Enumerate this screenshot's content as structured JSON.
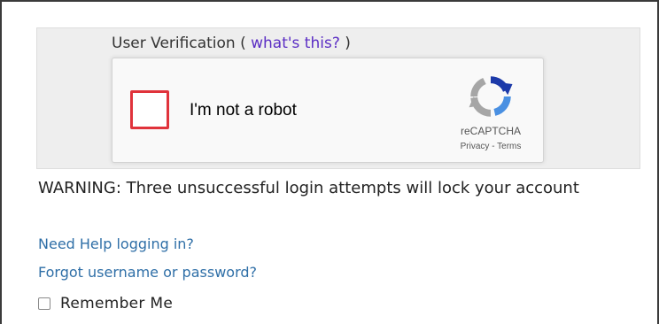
{
  "verification": {
    "label_before": "User Verification ( ",
    "link": "what's this?",
    "label_after": " )"
  },
  "recaptcha": {
    "checkbox_label": "I'm not a robot",
    "brand": "reCAPTCHA",
    "privacy": "Privacy",
    "separator": " - ",
    "terms": "Terms",
    "checkbox_border_color": "#e0333b",
    "icon": "recaptcha-logo-icon"
  },
  "warning": {
    "prefix": "WARNING:",
    "text": " Three unsuccessful login attempts will lock your account"
  },
  "links": {
    "help": "Need Help logging in?",
    "forgot": "Forgot username or password?"
  },
  "remember": {
    "label": "Remember Me",
    "checked": false
  },
  "colors": {
    "link": "#2f6fa7",
    "whats_this_link": "#5b2ec4",
    "panel_background": "#eeeeee"
  }
}
